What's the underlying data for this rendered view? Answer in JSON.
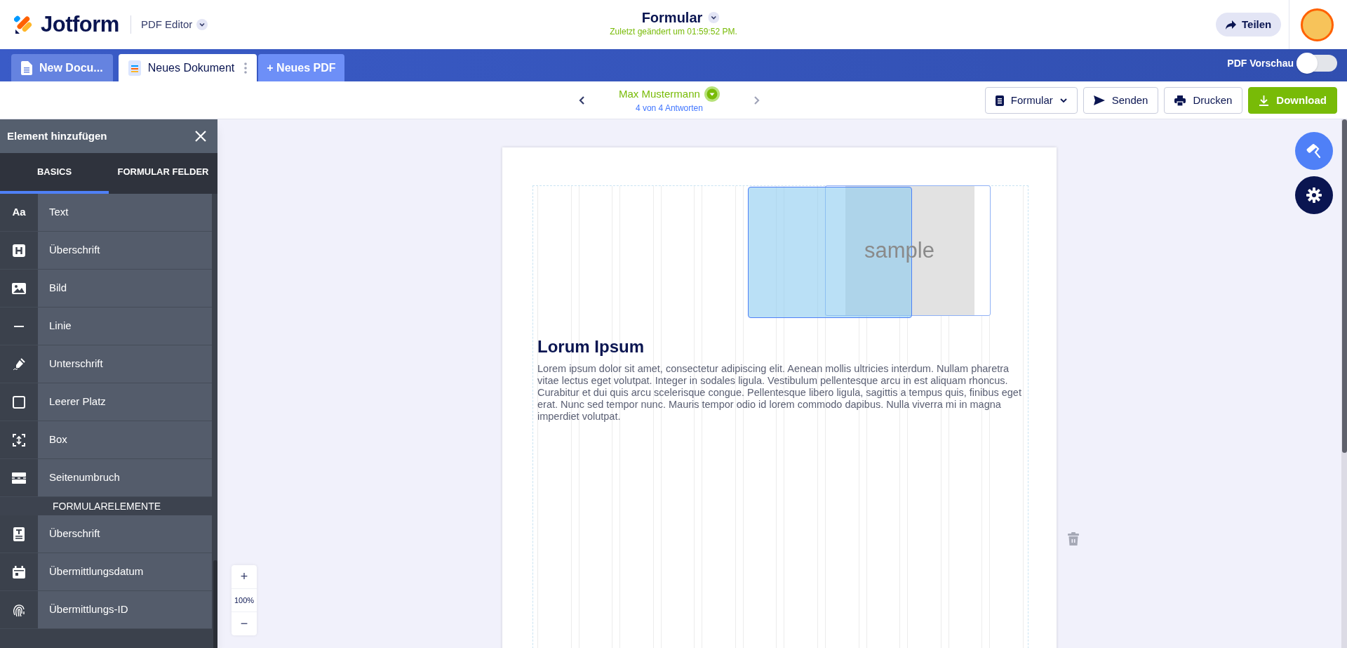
{
  "header": {
    "logo": "Jotform",
    "product": "PDF Editor",
    "title": "Formular",
    "last_saved": "Zuletzt geändert um 01:59:52 PM.",
    "share_button": "Teilen"
  },
  "tabs": [
    {
      "label": "New Docu...",
      "selected": false
    },
    {
      "label": "Neues Dokument",
      "selected": true
    }
  ],
  "new_pdf_button": "+ Neues PDF",
  "pdf_preview": {
    "label": "PDF Vorschau",
    "on": false
  },
  "submission_nav": {
    "name": "Max Mustermann",
    "count": "4 von 4 Antworten"
  },
  "actions": [
    {
      "label": "Formular",
      "kind": "dropdown"
    },
    {
      "label": "Senden",
      "kind": "send"
    },
    {
      "label": "Drucken",
      "kind": "print"
    },
    {
      "label": "Download",
      "kind": "download"
    }
  ],
  "panel": {
    "title": "Element hinzufügen",
    "tabs": [
      {
        "label": "BASICS",
        "selected": true
      },
      {
        "label": "FORMULAR FELDER",
        "selected": false
      }
    ],
    "sections": [
      {
        "items": [
          {
            "label": "Text",
            "glyph": "Aa"
          },
          {
            "label": "Überschrift"
          },
          {
            "label": "Bild"
          },
          {
            "label": "Linie"
          },
          {
            "label": "Unterschrift"
          },
          {
            "label": "Leerer Platz"
          },
          {
            "label": "Box"
          },
          {
            "label": "Seitenumbruch"
          }
        ]
      },
      {
        "heading": "FORMULARELEMENTE",
        "items": [
          {
            "label": "Überschrift"
          },
          {
            "label": "Übermittlungsdatum"
          },
          {
            "label": "Übermittlungs-ID"
          }
        ]
      }
    ]
  },
  "document": {
    "placeholder": "sample",
    "heading": "Lorum Ipsum",
    "body": "Lorem ipsum dolor sit amet, consectetur adipiscing elit. Aenean mollis ultricies interdum. Nullam pharetra vitae lectus eget volutpat. Integer in sodales ligula. Vestibulum pellentesque arcu in est aliquam rhoncus. Curabitur et dui quis arcu scelerisque congue. Pellentesque libero ligula, sagittis a tempus quis, finibus eget erat. Nunc sed tempor nunc. Mauris tempor odio id lorem commodo dapibus. Nulla viverra mi in magna imperdiet volutpat."
  },
  "zoom": {
    "in": "+",
    "value": "100%",
    "out": "−"
  }
}
